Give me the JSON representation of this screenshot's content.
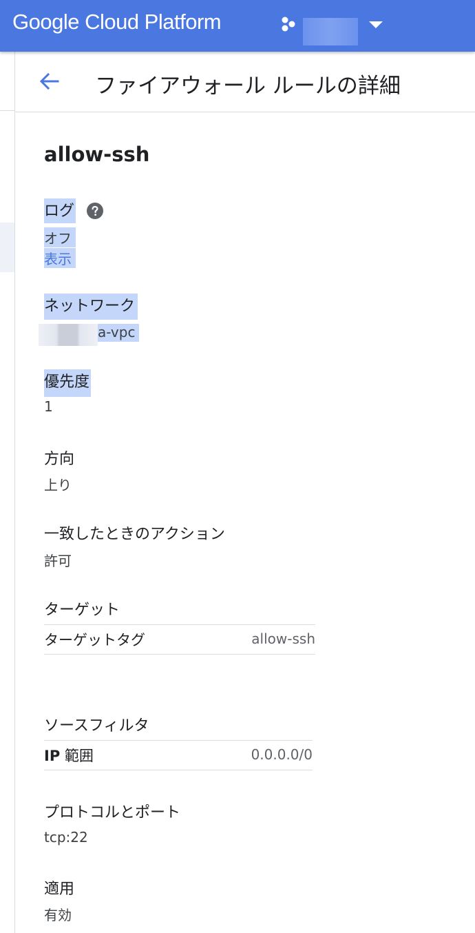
{
  "topbar": {
    "brand": "Google Cloud Platform",
    "project_icon": "project-hexagon-icon",
    "dropdown_icon": "caret-down-icon",
    "accent_color": "#4a77e0"
  },
  "header": {
    "back_icon": "arrow-back-icon",
    "title": "ファイアウォール ルールの詳細"
  },
  "rule": {
    "name": "allow-ssh",
    "log": {
      "label": "ログ",
      "value": "オフ",
      "link": "表示",
      "help_icon": "help-circle-icon"
    },
    "network": {
      "label": "ネットワーク",
      "value": "a-vpc"
    },
    "priority": {
      "label": "優先度",
      "value": "1"
    },
    "direction": {
      "label": "方向",
      "value": "上り"
    },
    "action": {
      "label": "一致したときのアクション",
      "value": "許可"
    },
    "targets": {
      "label": "ターゲット",
      "key": "ターゲットタグ",
      "value": "allow-ssh"
    },
    "source_filter": {
      "label": "ソースフィルタ",
      "key_bold": "IP",
      "key_rest": " 範囲",
      "value": "0.0.0.0/0"
    },
    "protocols": {
      "label": "プロトコルとポート",
      "value": "tcp:22"
    },
    "enforcement": {
      "label": "適用",
      "value": "有効"
    }
  }
}
